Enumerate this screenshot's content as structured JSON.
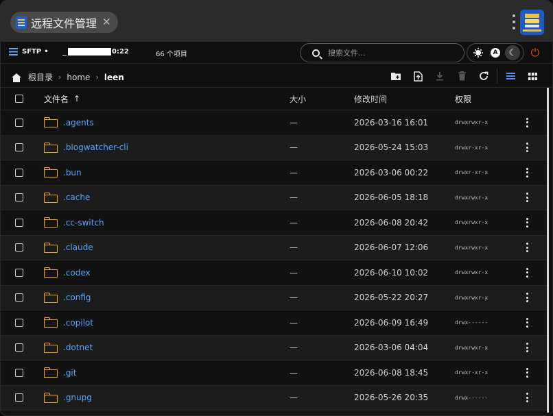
{
  "title_bar": {
    "tab_title": "远程文件管理",
    "close_glyph": "✕"
  },
  "toolbar": {
    "protocol": "SFTP",
    "status_dot": "•",
    "host_suffix": "0:22",
    "items_count": "66 个项目",
    "search_placeholder": "搜索文件...",
    "theme_auto_label": "A",
    "power_glyph": "⏻"
  },
  "breadcrumb": {
    "root": "根目录",
    "segments": [
      "home",
      "leen"
    ],
    "separator": "›"
  },
  "table": {
    "headers": {
      "name": "文件名",
      "size": "大小",
      "mtime": "修改时间",
      "perm": "权限",
      "sort_glyph": "↑"
    },
    "rows": [
      {
        "name": ".agents",
        "size": "—",
        "mtime": "2026-03-16 16:01",
        "perm": "drwxrwxr-x"
      },
      {
        "name": ".blogwatcher-cli",
        "size": "—",
        "mtime": "2026-05-24 15:03",
        "perm": "drwxr-xr-x"
      },
      {
        "name": ".bun",
        "size": "—",
        "mtime": "2026-03-06 00:22",
        "perm": "drwxr-xr-x"
      },
      {
        "name": ".cache",
        "size": "—",
        "mtime": "2026-06-05 18:18",
        "perm": "drwxrwxr-x"
      },
      {
        "name": ".cc-switch",
        "size": "—",
        "mtime": "2026-06-08 20:42",
        "perm": "drwxrwxr-x"
      },
      {
        "name": ".claude",
        "size": "—",
        "mtime": "2026-06-07 12:06",
        "perm": "drwxrwxr-x"
      },
      {
        "name": ".codex",
        "size": "—",
        "mtime": "2026-06-10 10:02",
        "perm": "drwxrwxr-x"
      },
      {
        "name": ".config",
        "size": "—",
        "mtime": "2026-05-22 20:27",
        "perm": "drwxrwxr-x"
      },
      {
        "name": ".copilot",
        "size": "—",
        "mtime": "2026-06-09 16:49",
        "perm": "drwx------"
      },
      {
        "name": ".dotnet",
        "size": "—",
        "mtime": "2026-03-06 04:04",
        "perm": "drwxrwxr-x"
      },
      {
        "name": ".git",
        "size": "—",
        "mtime": "2026-06-08 18:45",
        "perm": "drwxr-xr-x"
      },
      {
        "name": ".gnupg",
        "size": "—",
        "mtime": "2026-05-26 20:35",
        "perm": "drwx------"
      }
    ]
  },
  "colors": {
    "accent": "#4c8dff",
    "folder": "#f2ab15",
    "link": "#56a6ff",
    "power": "#e34b3c"
  }
}
